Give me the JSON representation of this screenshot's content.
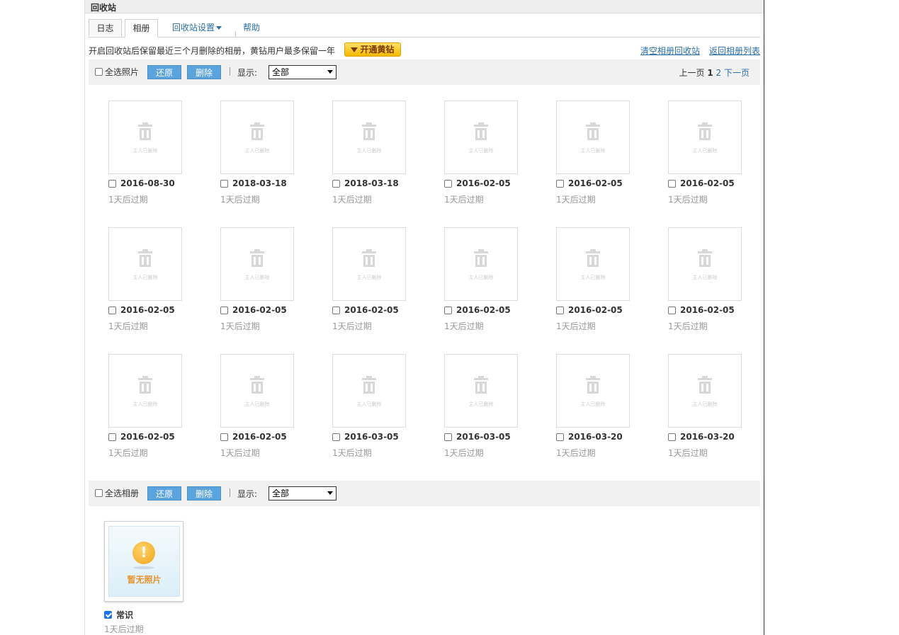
{
  "header": {
    "title": "回收站"
  },
  "tabs": [
    {
      "label": "日志"
    },
    {
      "label": "相册"
    },
    {
      "label": "回收站设置"
    },
    {
      "label": "帮助"
    }
  ],
  "notice": {
    "text": "开启回收站后保留最近三个月删除的相册，黄钻用户最多保留一年",
    "vip_button": "开通黄钻",
    "clear_link": "清空相册回收站",
    "back_link": "返回相册列表"
  },
  "photo_toolbar": {
    "select_all": "全选照片",
    "restore": "还原",
    "delete": "删除",
    "show_label": "显示:",
    "filter_value": "全部"
  },
  "pager": {
    "prev": "上一页",
    "current": "1",
    "page2": "2",
    "next": "下一页"
  },
  "photos": [
    {
      "date": "2016-08-30",
      "expire": "1天后过期"
    },
    {
      "date": "2018-03-18",
      "expire": "1天后过期"
    },
    {
      "date": "2018-03-18",
      "expire": "1天后过期"
    },
    {
      "date": "2016-02-05",
      "expire": "1天后过期"
    },
    {
      "date": "2016-02-05",
      "expire": "1天后过期"
    },
    {
      "date": "2016-02-05",
      "expire": "1天后过期"
    },
    {
      "date": "2016-02-05",
      "expire": "1天后过期"
    },
    {
      "date": "2016-02-05",
      "expire": "1天后过期"
    },
    {
      "date": "2016-02-05",
      "expire": "1天后过期"
    },
    {
      "date": "2016-02-05",
      "expire": "1天后过期"
    },
    {
      "date": "2016-02-05",
      "expire": "1天后过期"
    },
    {
      "date": "2016-02-05",
      "expire": "1天后过期"
    },
    {
      "date": "2016-02-05",
      "expire": "1天后过期"
    },
    {
      "date": "2016-02-05",
      "expire": "1天后过期"
    },
    {
      "date": "2016-03-05",
      "expire": "1天后过期"
    },
    {
      "date": "2016-03-05",
      "expire": "1天后过期"
    },
    {
      "date": "2016-03-20",
      "expire": "1天后过期"
    },
    {
      "date": "2016-03-20",
      "expire": "1天后过期"
    }
  ],
  "photo_placeholder_text": "主人已删除",
  "album_toolbar": {
    "select_all": "全选相册",
    "restore": "还原",
    "delete": "删除",
    "show_label": "显示:",
    "filter_value": "全部"
  },
  "album": {
    "cover_text": "暂无照片",
    "name": "常识",
    "expire": "1天后过期",
    "checked": true
  }
}
